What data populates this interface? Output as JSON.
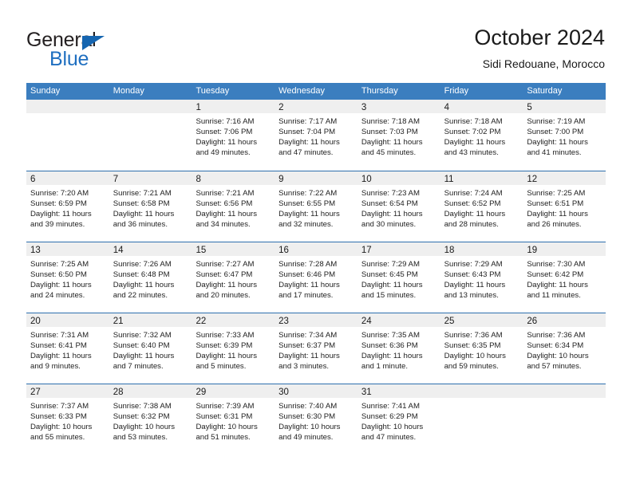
{
  "brand": {
    "name_part1": "General",
    "name_part2": "Blue",
    "accent_color": "#1565b0"
  },
  "header": {
    "title": "October 2024",
    "subtitle": "Sidi Redouane, Morocco"
  },
  "calendar": {
    "header_bg": "#3b7ebf",
    "weekdays": [
      "Sunday",
      "Monday",
      "Tuesday",
      "Wednesday",
      "Thursday",
      "Friday",
      "Saturday"
    ],
    "weeks": [
      [
        {
          "day": "",
          "sunrise": "",
          "sunset": "",
          "daylight": ""
        },
        {
          "day": "",
          "sunrise": "",
          "sunset": "",
          "daylight": ""
        },
        {
          "day": "1",
          "sunrise": "Sunrise: 7:16 AM",
          "sunset": "Sunset: 7:06 PM",
          "daylight": "Daylight: 11 hours and 49 minutes."
        },
        {
          "day": "2",
          "sunrise": "Sunrise: 7:17 AM",
          "sunset": "Sunset: 7:04 PM",
          "daylight": "Daylight: 11 hours and 47 minutes."
        },
        {
          "day": "3",
          "sunrise": "Sunrise: 7:18 AM",
          "sunset": "Sunset: 7:03 PM",
          "daylight": "Daylight: 11 hours and 45 minutes."
        },
        {
          "day": "4",
          "sunrise": "Sunrise: 7:18 AM",
          "sunset": "Sunset: 7:02 PM",
          "daylight": "Daylight: 11 hours and 43 minutes."
        },
        {
          "day": "5",
          "sunrise": "Sunrise: 7:19 AM",
          "sunset": "Sunset: 7:00 PM",
          "daylight": "Daylight: 11 hours and 41 minutes."
        }
      ],
      [
        {
          "day": "6",
          "sunrise": "Sunrise: 7:20 AM",
          "sunset": "Sunset: 6:59 PM",
          "daylight": "Daylight: 11 hours and 39 minutes."
        },
        {
          "day": "7",
          "sunrise": "Sunrise: 7:21 AM",
          "sunset": "Sunset: 6:58 PM",
          "daylight": "Daylight: 11 hours and 36 minutes."
        },
        {
          "day": "8",
          "sunrise": "Sunrise: 7:21 AM",
          "sunset": "Sunset: 6:56 PM",
          "daylight": "Daylight: 11 hours and 34 minutes."
        },
        {
          "day": "9",
          "sunrise": "Sunrise: 7:22 AM",
          "sunset": "Sunset: 6:55 PM",
          "daylight": "Daylight: 11 hours and 32 minutes."
        },
        {
          "day": "10",
          "sunrise": "Sunrise: 7:23 AM",
          "sunset": "Sunset: 6:54 PM",
          "daylight": "Daylight: 11 hours and 30 minutes."
        },
        {
          "day": "11",
          "sunrise": "Sunrise: 7:24 AM",
          "sunset": "Sunset: 6:52 PM",
          "daylight": "Daylight: 11 hours and 28 minutes."
        },
        {
          "day": "12",
          "sunrise": "Sunrise: 7:25 AM",
          "sunset": "Sunset: 6:51 PM",
          "daylight": "Daylight: 11 hours and 26 minutes."
        }
      ],
      [
        {
          "day": "13",
          "sunrise": "Sunrise: 7:25 AM",
          "sunset": "Sunset: 6:50 PM",
          "daylight": "Daylight: 11 hours and 24 minutes."
        },
        {
          "day": "14",
          "sunrise": "Sunrise: 7:26 AM",
          "sunset": "Sunset: 6:48 PM",
          "daylight": "Daylight: 11 hours and 22 minutes."
        },
        {
          "day": "15",
          "sunrise": "Sunrise: 7:27 AM",
          "sunset": "Sunset: 6:47 PM",
          "daylight": "Daylight: 11 hours and 20 minutes."
        },
        {
          "day": "16",
          "sunrise": "Sunrise: 7:28 AM",
          "sunset": "Sunset: 6:46 PM",
          "daylight": "Daylight: 11 hours and 17 minutes."
        },
        {
          "day": "17",
          "sunrise": "Sunrise: 7:29 AM",
          "sunset": "Sunset: 6:45 PM",
          "daylight": "Daylight: 11 hours and 15 minutes."
        },
        {
          "day": "18",
          "sunrise": "Sunrise: 7:29 AM",
          "sunset": "Sunset: 6:43 PM",
          "daylight": "Daylight: 11 hours and 13 minutes."
        },
        {
          "day": "19",
          "sunrise": "Sunrise: 7:30 AM",
          "sunset": "Sunset: 6:42 PM",
          "daylight": "Daylight: 11 hours and 11 minutes."
        }
      ],
      [
        {
          "day": "20",
          "sunrise": "Sunrise: 7:31 AM",
          "sunset": "Sunset: 6:41 PM",
          "daylight": "Daylight: 11 hours and 9 minutes."
        },
        {
          "day": "21",
          "sunrise": "Sunrise: 7:32 AM",
          "sunset": "Sunset: 6:40 PM",
          "daylight": "Daylight: 11 hours and 7 minutes."
        },
        {
          "day": "22",
          "sunrise": "Sunrise: 7:33 AM",
          "sunset": "Sunset: 6:39 PM",
          "daylight": "Daylight: 11 hours and 5 minutes."
        },
        {
          "day": "23",
          "sunrise": "Sunrise: 7:34 AM",
          "sunset": "Sunset: 6:37 PM",
          "daylight": "Daylight: 11 hours and 3 minutes."
        },
        {
          "day": "24",
          "sunrise": "Sunrise: 7:35 AM",
          "sunset": "Sunset: 6:36 PM",
          "daylight": "Daylight: 11 hours and 1 minute."
        },
        {
          "day": "25",
          "sunrise": "Sunrise: 7:36 AM",
          "sunset": "Sunset: 6:35 PM",
          "daylight": "Daylight: 10 hours and 59 minutes."
        },
        {
          "day": "26",
          "sunrise": "Sunrise: 7:36 AM",
          "sunset": "Sunset: 6:34 PM",
          "daylight": "Daylight: 10 hours and 57 minutes."
        }
      ],
      [
        {
          "day": "27",
          "sunrise": "Sunrise: 7:37 AM",
          "sunset": "Sunset: 6:33 PM",
          "daylight": "Daylight: 10 hours and 55 minutes."
        },
        {
          "day": "28",
          "sunrise": "Sunrise: 7:38 AM",
          "sunset": "Sunset: 6:32 PM",
          "daylight": "Daylight: 10 hours and 53 minutes."
        },
        {
          "day": "29",
          "sunrise": "Sunrise: 7:39 AM",
          "sunset": "Sunset: 6:31 PM",
          "daylight": "Daylight: 10 hours and 51 minutes."
        },
        {
          "day": "30",
          "sunrise": "Sunrise: 7:40 AM",
          "sunset": "Sunset: 6:30 PM",
          "daylight": "Daylight: 10 hours and 49 minutes."
        },
        {
          "day": "31",
          "sunrise": "Sunrise: 7:41 AM",
          "sunset": "Sunset: 6:29 PM",
          "daylight": "Daylight: 10 hours and 47 minutes."
        },
        {
          "day": "",
          "sunrise": "",
          "sunset": "",
          "daylight": ""
        },
        {
          "day": "",
          "sunrise": "",
          "sunset": "",
          "daylight": ""
        }
      ]
    ]
  }
}
